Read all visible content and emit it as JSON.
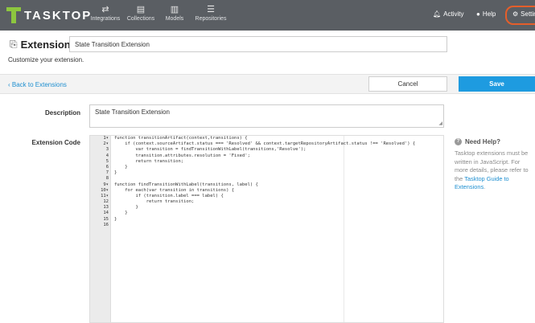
{
  "app": {
    "logo_text": "TASKTOP"
  },
  "nav": {
    "items": [
      {
        "label": "Integrations",
        "icon": "integrations-icon"
      },
      {
        "label": "Collections",
        "icon": "collections-icon"
      },
      {
        "label": "Models",
        "icon": "models-icon"
      },
      {
        "label": "Repositories",
        "icon": "repositories-icon"
      }
    ],
    "activity": "Activity",
    "help": "Help",
    "settings": "Settings"
  },
  "header": {
    "title": "Extension",
    "name_value": "State Transition Extension",
    "subtitle": "Customize your extension."
  },
  "actions": {
    "back": "Back to Extensions",
    "cancel": "Cancel",
    "save": "Save"
  },
  "form": {
    "description_label": "Description",
    "description_value": "State Transition Extension",
    "code_label": "Extension Code",
    "line_numbers": [
      "1",
      "2",
      "3",
      "4",
      "5",
      "6",
      "7",
      "8",
      "9",
      "10",
      "11",
      "12",
      "13",
      "14",
      "15",
      "16"
    ],
    "fold_markers": [
      "1",
      "2",
      "9",
      "10",
      "11"
    ],
    "code_lines": [
      "function transitionArtifact(context,transitions) {",
      "    if (context.sourceArtifact.status === 'Resolved' && context.targetRepositoryArtifact.status !== 'Resolved') {",
      "        var transition = findTransitionWithLabel(transitions,'Resolve');",
      "        transition.attributes.resolution = 'Fixed';",
      "        return transition;",
      "    }",
      "}",
      "",
      "function findTransitionWithLabel(transitions, label) {",
      "    for each(var transition in transitions) {",
      "        if (transition.label === label) {",
      "            return transition;",
      "        }",
      "    }",
      "}",
      ""
    ]
  },
  "help": {
    "title": "Need Help?",
    "body": "Tasktop extensions must be written in JavaScript. For more details, please refer to the ",
    "link": "Tasktop Guide to Extensions",
    "end": "."
  },
  "colors": {
    "topbar": "#5a5e63",
    "accent": "#1e9be0",
    "logo_green": "#8dc63f",
    "highlight_ring": "#e55e2a"
  }
}
